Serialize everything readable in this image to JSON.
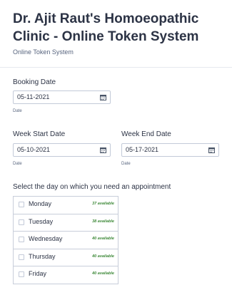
{
  "header": {
    "title": "Dr. Ajit Raut's Homoeopathic Clinic - Online Token System",
    "subtitle": "Online Token System"
  },
  "booking": {
    "label": "Booking Date",
    "value": "05-11-2021",
    "sublabel": "Date"
  },
  "week_start": {
    "label": "Week Start Date",
    "value": "05-10-2021",
    "sublabel": "Date"
  },
  "week_end": {
    "label": "Week End Date",
    "value": "05-17-2021",
    "sublabel": "Date"
  },
  "day_select": {
    "question": "Select the day on which you need an appointment",
    "options": [
      {
        "day": "Monday",
        "available": "37 available"
      },
      {
        "day": "Tuesday",
        "available": "38 available"
      },
      {
        "day": "Wednesday",
        "available": "40 available"
      },
      {
        "day": "Thursday",
        "available": "40 available"
      },
      {
        "day": "Friday",
        "available": "40 available"
      }
    ]
  },
  "icons": {
    "calendar": "calendar-icon",
    "checkbox": "checkbox-icon"
  },
  "colors": {
    "text": "#2c3345",
    "muted": "#57647e",
    "border": "#c8ceda",
    "available": "#3f8a3a"
  }
}
